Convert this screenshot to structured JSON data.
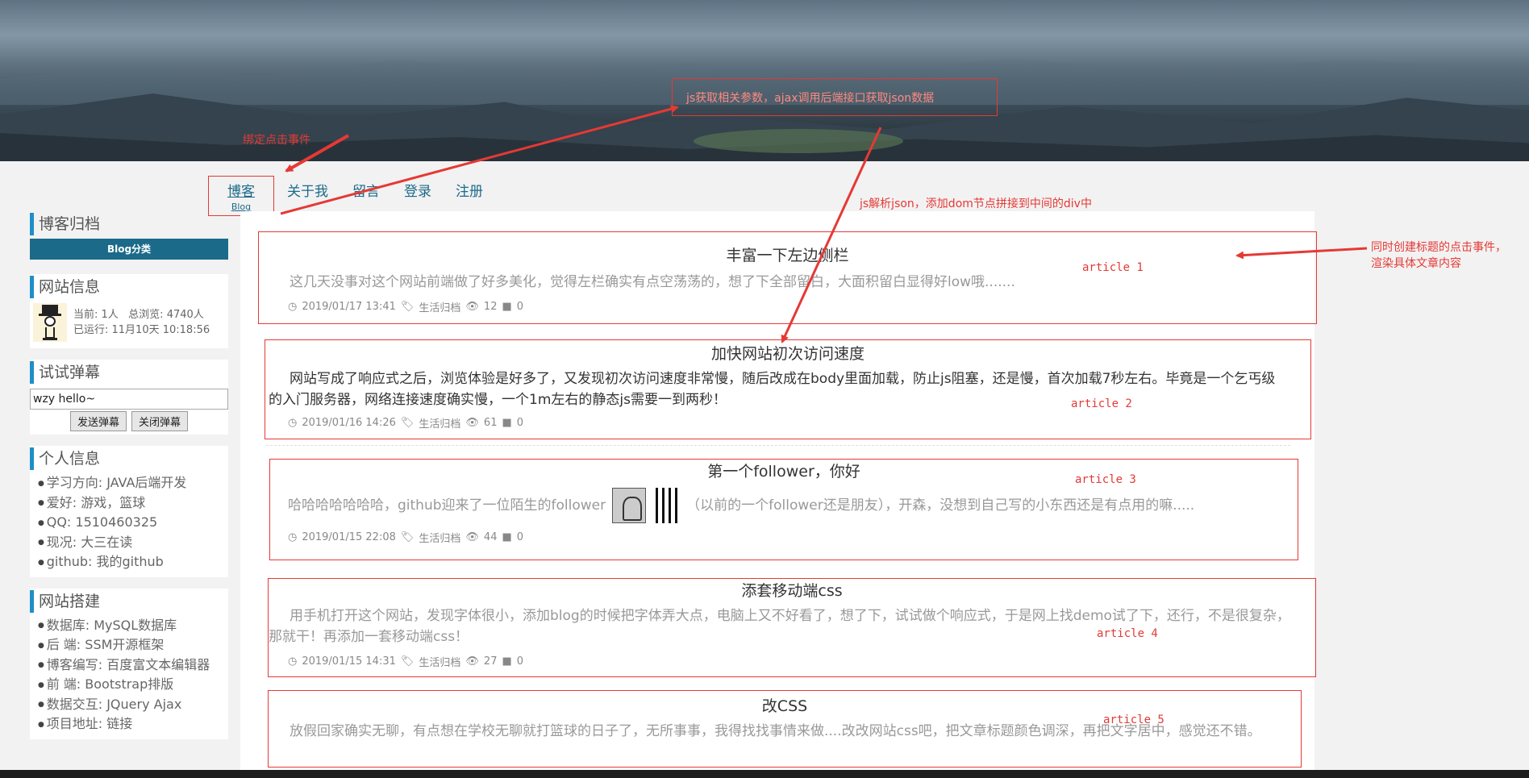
{
  "nav": {
    "items": [
      {
        "label": "博客",
        "sub": "Blog"
      },
      {
        "label": "关于我"
      },
      {
        "label": "留言"
      },
      {
        "label": "登录"
      },
      {
        "label": "注册"
      }
    ]
  },
  "sidebar": {
    "archive": {
      "title": "博客归档",
      "category": "Blog分类"
    },
    "site_info": {
      "title": "网站信息",
      "line1": "当前: 1人   总浏览: 4740人",
      "line2": "已运行: 11月10天 10:18:56"
    },
    "danmu": {
      "title": "试试弹幕",
      "input_value": "wzy hello~",
      "send_label": "发送弹幕",
      "close_label": "关闭弹幕"
    },
    "personal": {
      "title": "个人信息",
      "items": [
        "学习方向: JAVA后端开发",
        "爱好: 游戏，篮球",
        "QQ: 1510460325",
        "现况: 大三在读",
        "github: 我的github"
      ]
    },
    "build": {
      "title": "网站搭建",
      "items": [
        "数据库: MySQL数据库",
        "后 端: SSM开源框架",
        "博客编写: 百度富文本编辑器",
        "前 端: Bootstrap排版",
        "数据交互: JQuery Ajax",
        "项目地址: 链接"
      ]
    }
  },
  "articles": [
    {
      "title": "丰富一下左边侧栏",
      "body": "这几天没事对这个网站前端做了好多美化，觉得左栏确实有点空荡荡的，想了下全部留白，大面积留白显得好low哦.......",
      "date": "2019/01/17 13:41",
      "category": "生活归档",
      "views": "12",
      "comments": "0",
      "label": "article 1"
    },
    {
      "title": "加快网站初次访问速度",
      "body": "网站写成了响应式之后，浏览体验是好多了，又发现初次访问速度非常慢，随后改成在body里面加载，防止js阻塞，还是慢，首次加载7秒左右。毕竟是一个乞丐级的入门服务器，网络连接速度确实慢，一个1m左右的静态js需要一到两秒！",
      "date": "2019/01/16 14:26",
      "category": "生活归档",
      "views": "61",
      "comments": "0",
      "label": "article 2"
    },
    {
      "title": "第一个follower，你好",
      "body_before": "哈哈哈哈哈哈哈，github迎来了一位陌生的follower",
      "body_after": "（以前的一个follower还是朋友），开森，没想到自己写的小东西还是有点用的嘛.....",
      "date": "2019/01/15 22:08",
      "category": "生活归档",
      "views": "44",
      "comments": "0",
      "label": "article 3"
    },
    {
      "title": "添套移动端css",
      "body": "用手机打开这个网站，发现字体很小，添加blog的时候把字体弄大点，电脑上又不好看了，想了下，试试做个响应式，于是网上找demo试了下，还行，不是很复杂，那就干！再添加一套移动端css！",
      "date": "2019/01/15 14:31",
      "category": "生活归档",
      "views": "27",
      "comments": "0",
      "label": "article 4"
    },
    {
      "title": "改CSS",
      "body": "放假回家确实无聊，有点想在学校无聊就打篮球的日子了，无所事事，我得找找事情来做....改改网站css吧，把文章标题颜色调深，再把文字居中，感觉还不错。",
      "label": "article 5"
    }
  ],
  "annotations": {
    "click_event": "绑定点击事件",
    "ajax": "js获取相关参数，ajax调用后端接口获取json数据",
    "parse": "js解析json，添加dom节点拼接到中间的div中",
    "title_click_1": "同时创建标题的点击事件，",
    "title_click_2": "渲染具体文章内容"
  },
  "colors": {
    "accent": "#1b6a8a",
    "annotation": "#e53935",
    "sidebar_bar": "#1e8fc8"
  }
}
